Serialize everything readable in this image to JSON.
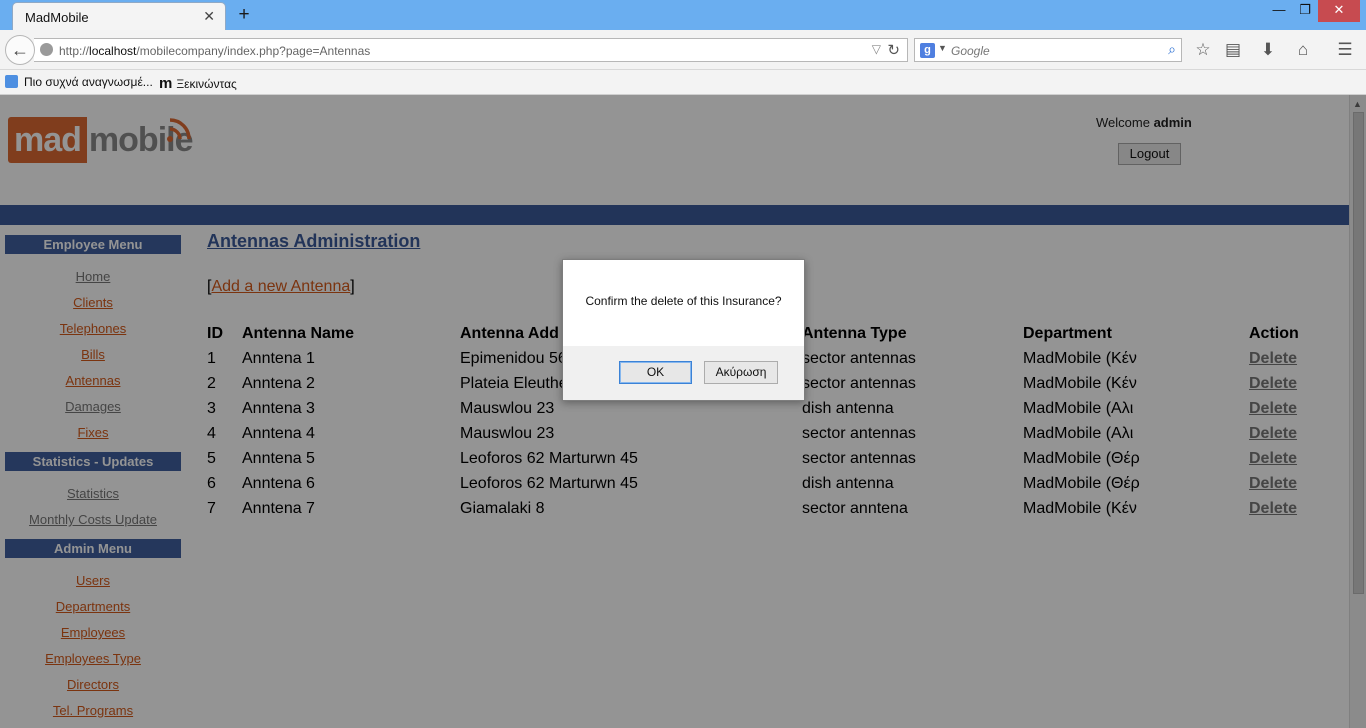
{
  "browser": {
    "tab_title": "MadMobile",
    "tab_close": "✕",
    "new_tab": "+",
    "window_controls": {
      "minimize": "—",
      "maximize": "❐",
      "close": "✕"
    },
    "url_protocol": "http://",
    "url_host": "localhost",
    "url_path": "/mobilecompany/index.php?page=Antennas",
    "search_placeholder": "Google",
    "search_engine_icon": "g-logo-icon",
    "bookmarks": [
      {
        "label": "Πιο συχνά αναγνωσμέ...",
        "icon": "bookmark-folder-icon"
      },
      {
        "label": "Ξεκινώντας",
        "icon": "mozilla-m-icon"
      }
    ]
  },
  "header": {
    "logo_mad": "mad",
    "logo_mobile": "mobile",
    "welcome_prefix": "Welcome",
    "username": "admin",
    "logout_label": "Logout"
  },
  "sidebar": {
    "employee_menu_title": "Employee Menu",
    "employee_items": [
      {
        "label": "Home",
        "style": "gray"
      },
      {
        "label": "Clients",
        "style": "orange"
      },
      {
        "label": "Telephones",
        "style": "orange"
      },
      {
        "label": "Bills",
        "style": "orange"
      },
      {
        "label": "Antennas",
        "style": "orange"
      },
      {
        "label": "Damages",
        "style": "gray"
      },
      {
        "label": "Fixes",
        "style": "orange"
      }
    ],
    "stats_menu_title": "Statistics - Updates",
    "stats_items": [
      {
        "label": "Statistics",
        "style": "gray"
      },
      {
        "label": "Monthly Costs Update",
        "style": "gray"
      }
    ],
    "admin_menu_title": "Admin Menu",
    "admin_items": [
      {
        "label": "Users",
        "style": "orange"
      },
      {
        "label": "Departments",
        "style": "orange"
      },
      {
        "label": "Employees",
        "style": "orange"
      },
      {
        "label": "Employees Type",
        "style": "orange"
      },
      {
        "label": "Directors",
        "style": "orange"
      },
      {
        "label": "Tel. Programs",
        "style": "orange"
      }
    ]
  },
  "main": {
    "title": "Antennas Administration",
    "add_link": "Add a new Antenna",
    "columns": [
      "ID",
      "Antenna Name",
      "Antenna Add",
      "Antenna Type",
      "Department",
      "Action"
    ],
    "rows": [
      {
        "id": "1",
        "name": "Anntena 1",
        "address": "Epimenidou 56",
        "type": "sector antennas",
        "department": "MadMobile (Κέν",
        "action": "Delete"
      },
      {
        "id": "2",
        "name": "Anntena 2",
        "address": "Plateia Eleuthe",
        "type": "sector antennas",
        "department": "MadMobile (Κέν",
        "action": "Delete"
      },
      {
        "id": "3",
        "name": "Anntena 3",
        "address": "Mauswlou 23",
        "type": "dish antenna",
        "department": "MadMobile (Αλι",
        "action": "Delete"
      },
      {
        "id": "4",
        "name": "Anntena 4",
        "address": "Mauswlou 23",
        "type": "sector antennas",
        "department": "MadMobile (Αλι",
        "action": "Delete"
      },
      {
        "id": "5",
        "name": "Anntena 5",
        "address": "Leoforos 62 Marturwn 45",
        "type": "sector antennas",
        "department": "MadMobile (Θέρ",
        "action": "Delete"
      },
      {
        "id": "6",
        "name": "Anntena 6",
        "address": "Leoforos 62 Marturwn 45",
        "type": "dish antenna",
        "department": "MadMobile (Θέρ",
        "action": "Delete"
      },
      {
        "id": "7",
        "name": "Anntena 7",
        "address": "Giamalaki 8",
        "type": "sector anntena",
        "department": "MadMobile (Κέν",
        "action": "Delete"
      }
    ]
  },
  "dialog": {
    "message": "Confirm the delete of this Insurance?",
    "ok_label": "OK",
    "cancel_label": "Ακύρωση"
  },
  "colors": {
    "menu_header": "#40609f",
    "link_orange": "#d45a1b",
    "link_gray": "#777777",
    "logo_orange": "#dd6a33",
    "titlebar": "#6aaef0"
  }
}
